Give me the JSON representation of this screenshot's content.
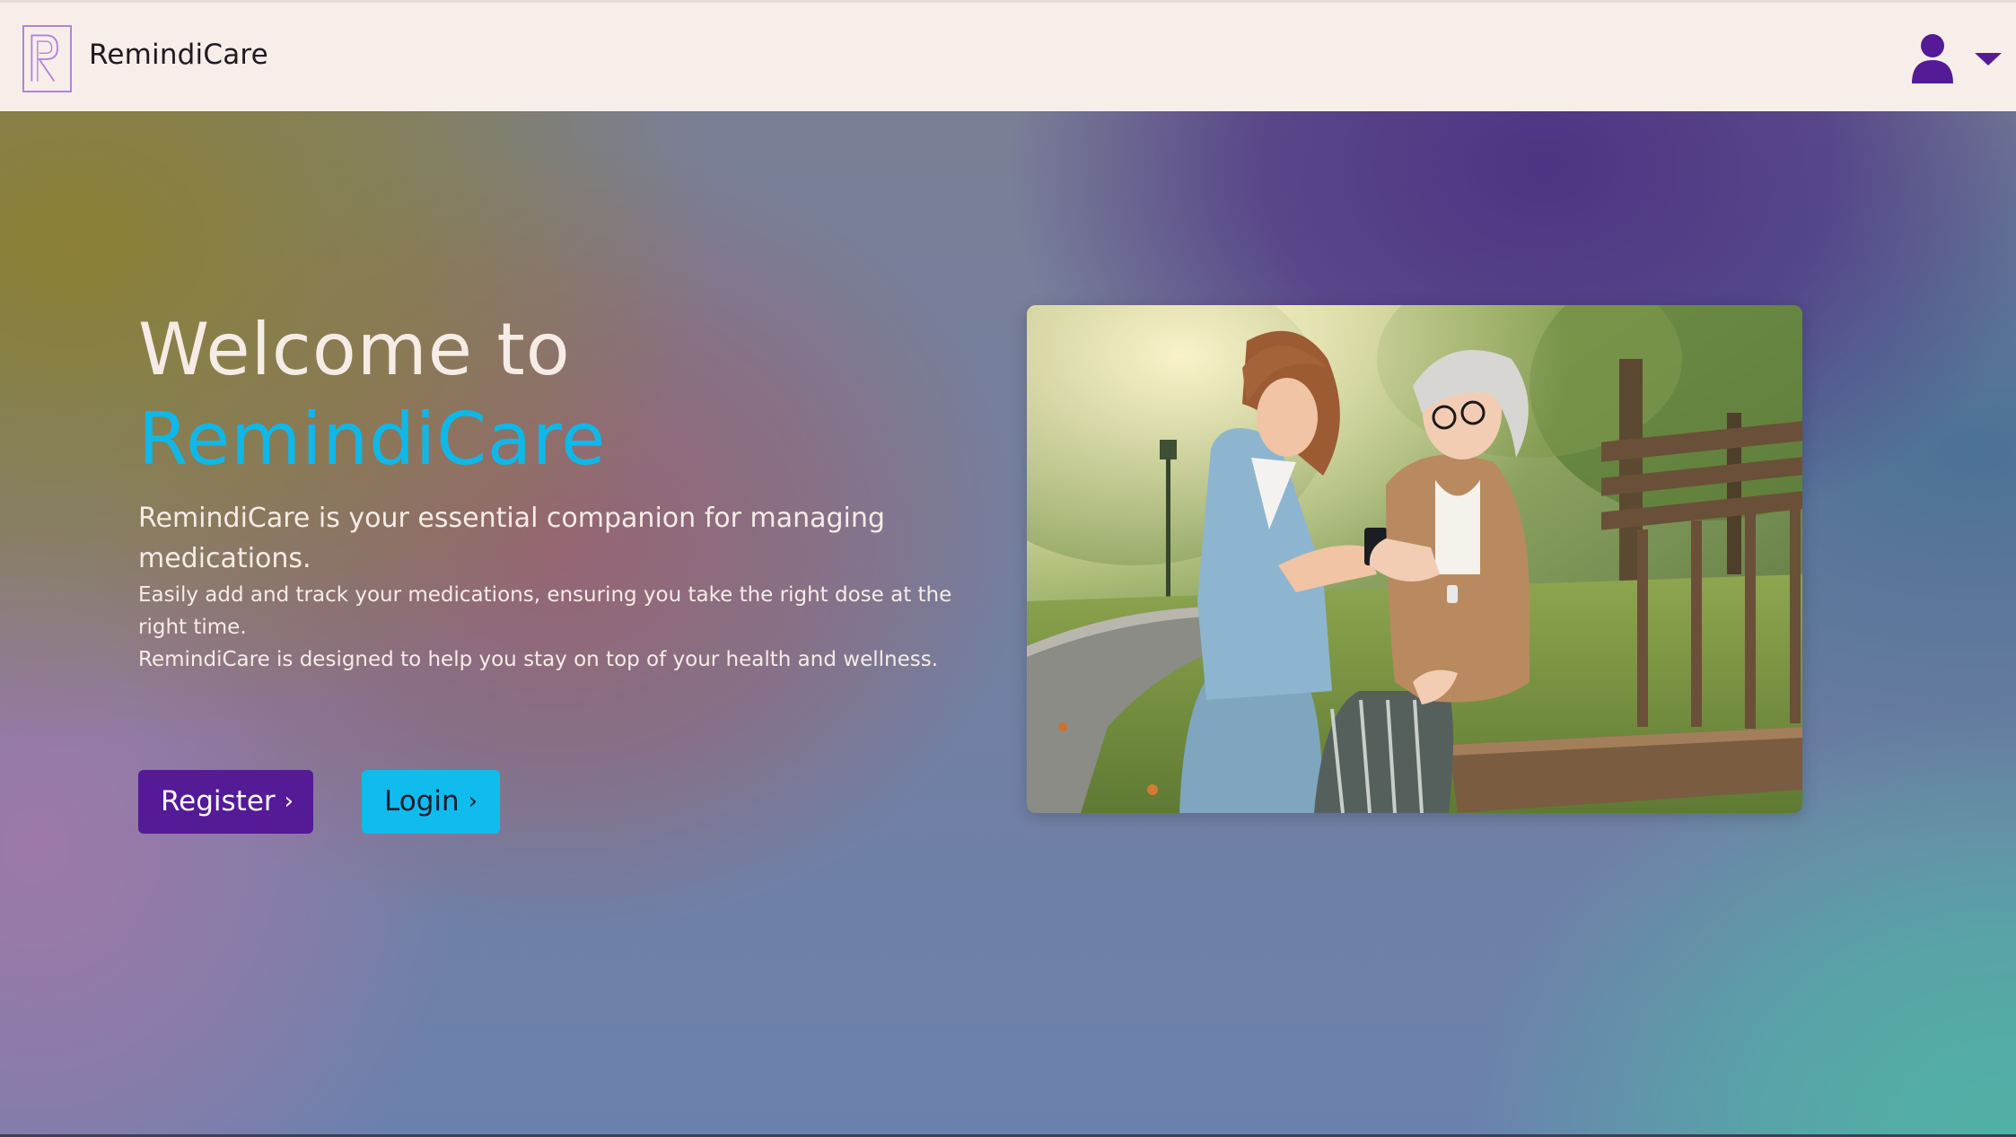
{
  "header": {
    "brand": "RemindiCare",
    "logo_icon": "remindicare-logo-icon",
    "user_icon": "user-icon",
    "caret_icon": "caret-down-icon"
  },
  "hero": {
    "title_line1": "Welcome to",
    "title_line2": "RemindiCare",
    "lead": "RemindiCare is your essential companion for managing medications.",
    "desc_line1": "Easily add and track your medications, ensuring you take the right dose at the right time.",
    "desc_line2": "RemindiCare is designed to help you stay on top of your health and wellness.",
    "register_label": "Register",
    "login_label": "Login"
  },
  "colors": {
    "navbar_bg": "#f7eeea",
    "accent_cyan": "#10bced",
    "accent_purple": "#551a96",
    "logo_stroke": "#b184d8"
  }
}
